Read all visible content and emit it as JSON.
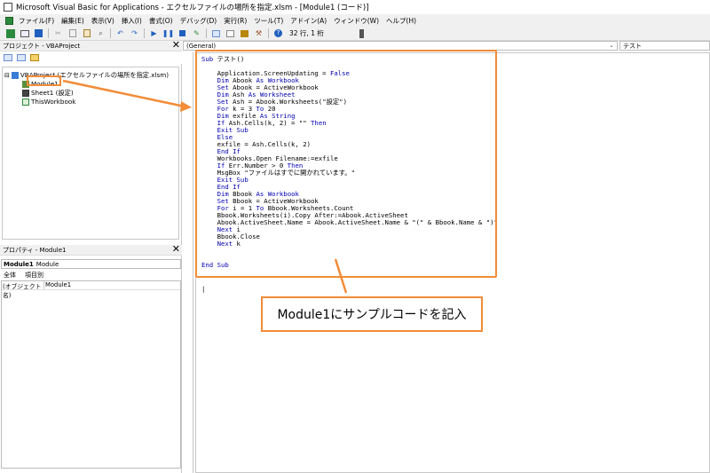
{
  "window": {
    "title": "Microsoft Visual Basic for Applications - エクセルファイルの場所を指定.xlsm - [Module1 (コード)]"
  },
  "menu": [
    "ファイル(F)",
    "編集(E)",
    "表示(V)",
    "挿入(I)",
    "書式(O)",
    "デバッグ(D)",
    "実行(R)",
    "ツール(T)",
    "アドイン(A)",
    "ウィンドウ(W)",
    "ヘルプ(H)"
  ],
  "toolbar": {
    "position": "32 行, 1 桁"
  },
  "project": {
    "title": "プロジェクト - VBAProject",
    "root": "VBAProject (エクセルファイルの場所を指定.xlsm)",
    "items": [
      "Module1",
      "Sheet1 (設定)",
      "ThisWorkbook"
    ]
  },
  "properties": {
    "title": "プロパティ - Module1",
    "object_name": "Module1",
    "object_type": "Module",
    "tabs": [
      "全体",
      "項目別"
    ],
    "row_key": "(オブジェクト名)",
    "row_value": "Module1"
  },
  "editor": {
    "object_combo": "(General)",
    "proc_combo": "テスト",
    "lines": [
      "Sub テスト()",
      "",
      "    Application.ScreenUpdating = False",
      "    Dim Abook As Workbook",
      "    Set Abook = ActiveWorkbook",
      "    Dim Ash As Worksheet",
      "    Set Ash = Abook.Worksheets(\"設定\")",
      "    For k = 3 To 20",
      "    Dim exfile As String",
      "    If Ash.Cells(k, 2) = \"\" Then",
      "    Exit Sub",
      "    Else",
      "    exfile = Ash.Cells(k, 2)",
      "    End If",
      "    Workbooks.Open Filename:=exfile",
      "    If Err.Number > 0 Then",
      "    MsgBox \"ファイルはすでに開かれています。\"",
      "    Exit Sub",
      "    End If",
      "    Dim Bbook As Workbook",
      "    Set Bbook = ActiveWorkbook",
      "    For i = 1 To Bbook.Worksheets.Count",
      "    Bbook.Worksheets(i).Copy After:=Abook.ActiveSheet",
      "    Abook.ActiveSheet.Name = Abook.ActiveSheet.Name & \"(\" & Bbook.Name & \")\"",
      "    Next i",
      "    Bbook.Close",
      "    Next k",
      "",
      "",
      "End Sub"
    ]
  },
  "annotation": {
    "callout": "Module1にサンプルコードを記入"
  },
  "colors": {
    "accent": "#f28c38",
    "keyword": "#0000b0"
  }
}
